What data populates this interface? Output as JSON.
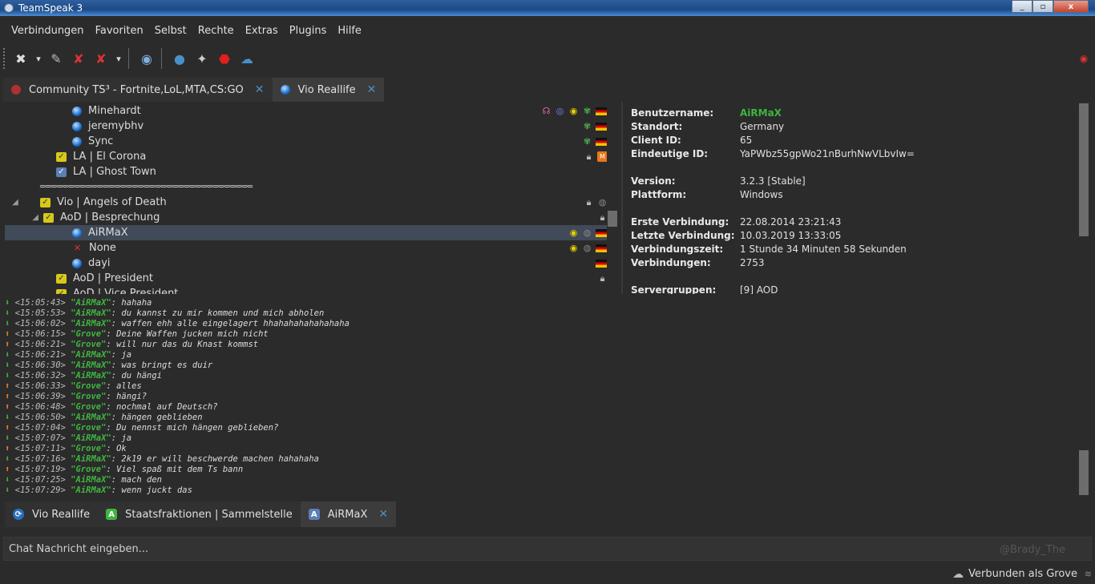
{
  "window": {
    "title": "TeamSpeak 3",
    "minimize": "_",
    "maximize": "▫",
    "close": "x"
  },
  "menu": [
    "Verbindungen",
    "Favoriten",
    "Selbst",
    "Rechte",
    "Extras",
    "Plugins",
    "Hilfe"
  ],
  "tabs_top": [
    {
      "label": "Community TS³ - Fortnite,LoL,MTA,CS:GO",
      "close": "✕"
    },
    {
      "label": "Vio Reallife",
      "close": "✕"
    }
  ],
  "tree": {
    "clients_top": [
      "Minehardt",
      "jeremybhv",
      "Sync"
    ],
    "channels_top": [
      "LA | El Corona",
      "LA | Ghost Town"
    ],
    "spacer": "═·═·═·═·═·═·═·═·═·═·═·═·═·═·═·═·═·═·═·═·═·═·═·═·═·═·═·═·═·═·═·═·═·═·═·═·═",
    "server_group": "Vio | Angels of Death",
    "sub_channel": "AoD | Besprechung",
    "selected_client": "AiRMaX",
    "client_none": "None",
    "client_dayi": "dayi",
    "channel_president": "AoD | President",
    "channel_vice": "AoD | Vice President"
  },
  "info": {
    "rows": [
      {
        "k": "Benutzername:",
        "v": "AiRMaX"
      },
      {
        "k": "Standort:",
        "v": "Germany"
      },
      {
        "k": "Client ID:",
        "v": "65"
      },
      {
        "k": "Eindeutige ID:",
        "v": "YaPWbz55gpWo21nBurhNwVLbvIw="
      },
      {
        "k": "Version:",
        "v": "3.2.3 [Stable]"
      },
      {
        "k": "Plattform:",
        "v": "Windows"
      },
      {
        "k": "Erste Verbindung:",
        "v": "22.08.2014 23:21:43"
      },
      {
        "k": "Letzte Verbindung:",
        "v": "10.03.2019 13:33:05"
      },
      {
        "k": "Verbindungszeit:",
        "v": "1 Stunde 34 Minuten 58 Sekunden"
      },
      {
        "k": "Verbindungen:",
        "v": "2753"
      },
      {
        "k": "Servergruppen:",
        "v": "[9] AOD"
      }
    ],
    "name_color": "#3fb53f"
  },
  "chat": [
    {
      "dir": "down",
      "time": "<15:05:43>",
      "name": "\"AiRMaX\"",
      "msg": ": hahaha"
    },
    {
      "dir": "down",
      "time": "<15:05:53>",
      "name": "\"AiRMaX\"",
      "msg": ": du kannst zu mir kommen und mich abholen"
    },
    {
      "dir": "down",
      "time": "<15:06:02>",
      "name": "\"AiRMaX\"",
      "msg": ": waffen ehh alle eingelagert hhahahahahahahaha"
    },
    {
      "dir": "up",
      "time": "<15:06:15>",
      "name": "\"Grove\"",
      "msg": ": Deine Waffen jucken mich nicht"
    },
    {
      "dir": "up",
      "time": "<15:06:21>",
      "name": "\"Grove\"",
      "msg": ": will nur das du Knast kommst"
    },
    {
      "dir": "down",
      "time": "<15:06:21>",
      "name": "\"AiRMaX\"",
      "msg": ": ja"
    },
    {
      "dir": "down",
      "time": "<15:06:30>",
      "name": "\"AiRMaX\"",
      "msg": ": was bringt es duir"
    },
    {
      "dir": "down",
      "time": "<15:06:32>",
      "name": "\"AiRMaX\"",
      "msg": ": du hängi"
    },
    {
      "dir": "up",
      "time": "<15:06:33>",
      "name": "\"Grove\"",
      "msg": ": alles"
    },
    {
      "dir": "up",
      "time": "<15:06:39>",
      "name": "\"Grove\"",
      "msg": ": hängi?"
    },
    {
      "dir": "up",
      "time": "<15:06:48>",
      "name": "\"Grove\"",
      "msg": ": nochmal auf Deutsch?"
    },
    {
      "dir": "down",
      "time": "<15:06:50>",
      "name": "\"AiRMaX\"",
      "msg": ": hängen geblieben"
    },
    {
      "dir": "up",
      "time": "<15:07:04>",
      "name": "\"Grove\"",
      "msg": ": Du nennst mich hängen geblieben?"
    },
    {
      "dir": "down",
      "time": "<15:07:07>",
      "name": "\"AiRMaX\"",
      "msg": ": ja"
    },
    {
      "dir": "up",
      "time": "<15:07:11>",
      "name": "\"Grove\"",
      "msg": ": Ok"
    },
    {
      "dir": "down",
      "time": "<15:07:16>",
      "name": "\"AiRMaX\"",
      "msg": ": 2k19 er will beschwerde machen hahahaha"
    },
    {
      "dir": "up",
      "time": "<15:07:19>",
      "name": "\"Grove\"",
      "msg": ": Viel spaß mit dem Ts bann"
    },
    {
      "dir": "down",
      "time": "<15:07:25>",
      "name": "\"AiRMaX\"",
      "msg": ": mach den"
    },
    {
      "dir": "down",
      "time": "<15:07:29>",
      "name": "\"AiRMaX\"",
      "msg": ": wenn juckt das"
    }
  ],
  "tabs_bottom": [
    {
      "label": "Vio Reallife"
    },
    {
      "label": "Staatsfraktionen | Sammelstelle"
    },
    {
      "label": "AiRMaX",
      "close": "✕"
    }
  ],
  "input": {
    "placeholder": "Chat Nachricht eingeben...",
    "watermark": "@Brady_The"
  },
  "status": {
    "text": "Verbunden als Grove"
  }
}
